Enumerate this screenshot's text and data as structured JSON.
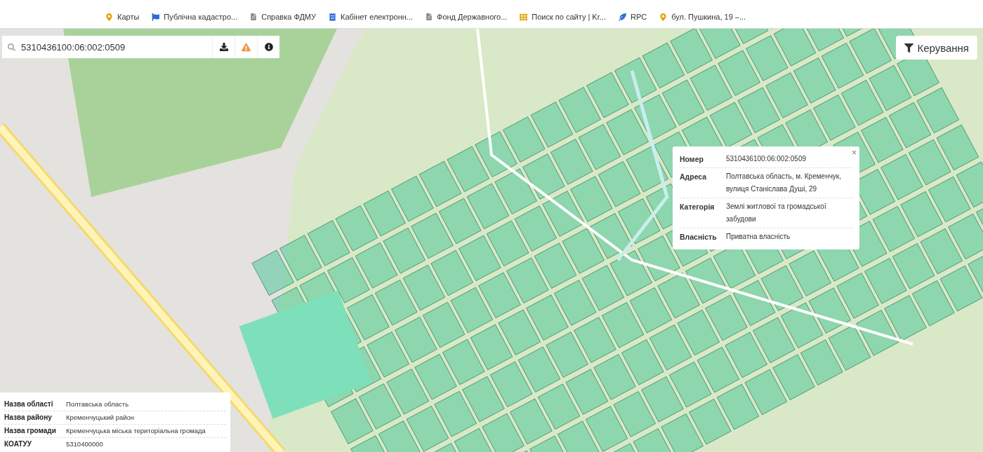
{
  "bookmarks": [
    {
      "label": "Карты",
      "kind": "pin"
    },
    {
      "label": "Публічна кадастро...",
      "kind": "flag"
    },
    {
      "label": "Справка ФДМУ",
      "kind": "doc"
    },
    {
      "label": "Кабінет електронн...",
      "kind": "tax"
    },
    {
      "label": "Фонд Державного...",
      "kind": "doc"
    },
    {
      "label": "Поиск по сайту | Kr...",
      "kind": "grid"
    },
    {
      "label": "RPC",
      "kind": "wing"
    },
    {
      "label": "бул. Пушкина, 19 –...",
      "kind": "pin"
    }
  ],
  "search": {
    "value": "5310436100:06:002:0509"
  },
  "control_button": {
    "label": "Керування"
  },
  "popup": {
    "rows": [
      {
        "label": "Номер",
        "value": "5310436100:06:002:0509"
      },
      {
        "label": "Адреса",
        "value": "Полтавська область, м. Кременчук, вулиця Станіслава Душі, 29"
      },
      {
        "label": "Категорія",
        "value": "Землі житлової та громадської забудови"
      },
      {
        "label": "Власність",
        "value": "Приватна власність"
      }
    ],
    "close": "×"
  },
  "info_panel": {
    "rows": [
      {
        "label": "Назва області",
        "value": "Полтавська область"
      },
      {
        "label": "Назва району",
        "value": "Кременчуцький район"
      },
      {
        "label": "Назва громади",
        "value": "Кременчуцька міська територіальна громада"
      },
      {
        "label": "КОАТУУ",
        "value": "5310400000"
      }
    ]
  }
}
